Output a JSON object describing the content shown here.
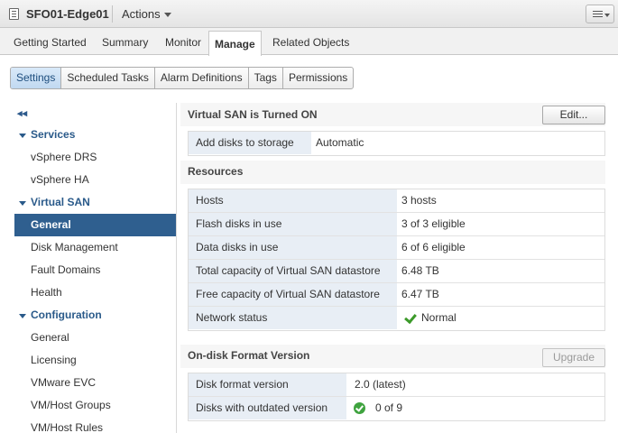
{
  "header": {
    "title": "SFO01-Edge01",
    "actions_label": "Actions"
  },
  "main_tabs": [
    "Getting Started",
    "Summary",
    "Monitor",
    "Manage",
    "Related Objects"
  ],
  "sub_tabs": [
    "Settings",
    "Scheduled Tasks",
    "Alarm Definitions",
    "Tags",
    "Permissions"
  ],
  "sidebar": {
    "collapse_glyph": "◂◂",
    "items": [
      {
        "label": "Services",
        "type": "section"
      },
      {
        "label": "vSphere DRS",
        "type": "item"
      },
      {
        "label": "vSphere HA",
        "type": "item"
      },
      {
        "label": "Virtual SAN",
        "type": "section"
      },
      {
        "label": "General",
        "type": "item",
        "selected": true
      },
      {
        "label": "Disk Management",
        "type": "item"
      },
      {
        "label": "Fault Domains",
        "type": "item"
      },
      {
        "label": "Health",
        "type": "item"
      },
      {
        "label": "Configuration",
        "type": "section"
      },
      {
        "label": "General",
        "type": "item"
      },
      {
        "label": "Licensing",
        "type": "item"
      },
      {
        "label": "VMware EVC",
        "type": "item"
      },
      {
        "label": "VM/Host Groups",
        "type": "item"
      },
      {
        "label": "VM/Host Rules",
        "type": "item"
      }
    ]
  },
  "vsan": {
    "title": "Virtual SAN is Turned ON",
    "edit_label": "Edit...",
    "rows": [
      {
        "key": "Add disks to storage",
        "value": "Automatic"
      }
    ]
  },
  "resources": {
    "title": "Resources",
    "rows": [
      {
        "key": "Hosts",
        "value": "3 hosts"
      },
      {
        "key": "Flash disks in use",
        "value": "3 of 3 eligible"
      },
      {
        "key": "Data disks in use",
        "value": "6 of 6 eligible"
      },
      {
        "key": "Total capacity of Virtual SAN datastore",
        "value": "6.48 TB"
      },
      {
        "key": "Free capacity of Virtual SAN datastore",
        "value": "6.47 TB"
      },
      {
        "key": "Network status",
        "value": "Normal",
        "icon": "green-check-icon"
      }
    ]
  },
  "disk_format": {
    "title": "On-disk Format Version",
    "upgrade_label": "Upgrade",
    "rows": [
      {
        "key": "Disk format version",
        "value": "2.0 (latest)"
      },
      {
        "key": "Disks with outdated version",
        "value": "0 of 9",
        "icon": "green-ok-circle-icon"
      }
    ]
  },
  "colors": {
    "selected_nav": "#2f5f8f",
    "section_label": "#2a5a8a",
    "key_cell_bg": "#e8eef5",
    "status_green": "#3c9a2a"
  }
}
